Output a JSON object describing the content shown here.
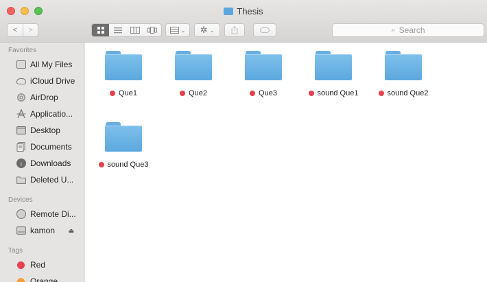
{
  "window": {
    "title": "Thesis"
  },
  "toolbar": {
    "back_glyph": "<",
    "forward_glyph": ">",
    "view_modes": [
      "icon-view",
      "list-view",
      "column-view",
      "cover-flow-view"
    ],
    "search_placeholder": "Search"
  },
  "sidebar": {
    "favorites_header": "Favorites",
    "favorites": [
      {
        "label": "All My Files",
        "icon": "all-files-icon"
      },
      {
        "label": "iCloud Drive",
        "icon": "cloud-icon"
      },
      {
        "label": "AirDrop",
        "icon": "airdrop-icon"
      },
      {
        "label": "Applicatio...",
        "icon": "applications-icon"
      },
      {
        "label": "Desktop",
        "icon": "desktop-icon"
      },
      {
        "label": "Documents",
        "icon": "documents-icon"
      },
      {
        "label": "Downloads",
        "icon": "downloads-icon"
      },
      {
        "label": "Deleted U...",
        "icon": "folder-icon"
      }
    ],
    "devices_header": "Devices",
    "devices": [
      {
        "label": "Remote Di...",
        "icon": "disc-icon"
      },
      {
        "label": "kamon",
        "icon": "drive-icon",
        "eject": "⏏"
      }
    ],
    "tags_header": "Tags",
    "tags": [
      {
        "label": "Red",
        "color": "#e5424d"
      },
      {
        "label": "Orange",
        "color": "#f5a13b"
      }
    ]
  },
  "files": [
    {
      "name": "Que1",
      "tag_color": "#e5424d"
    },
    {
      "name": "Que2",
      "tag_color": "#e5424d"
    },
    {
      "name": "Que3",
      "tag_color": "#e5424d"
    },
    {
      "name": "sound Que1",
      "tag_color": "#e5424d"
    },
    {
      "name": "sound Que2",
      "tag_color": "#e5424d"
    },
    {
      "name": "sound Que3",
      "tag_color": "#e5424d"
    }
  ],
  "colors": {
    "folder": "#5ca8de",
    "tag_red": "#e5424d"
  }
}
